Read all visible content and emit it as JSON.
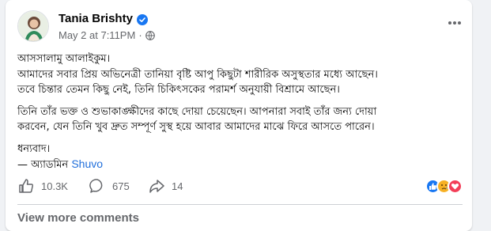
{
  "post": {
    "author": "Tania Brishty",
    "timestamp": "May 2 at 7:11PM",
    "separator": "·",
    "verified": true,
    "lines": [
      "আসসালামু আলাইকুম।",
      "আমাদের সবার প্রিয় অভিনেত্রী তানিয়া বৃষ্টি আপু কিছুটা শারীরিক অসুস্থতার মধ্যে আছেন।",
      "তবে চিন্তার তেমন কিছু নেই, তিনি চিকিৎসকের পরামর্শ অনুযায়ী বিশ্রামে আছেন।",
      "তিনি তাঁর ভক্ত ও শুভাকাঙ্ক্ষীদের কাছে দোয়া চেয়েছেন। আপনারা সবাই তাঁর জন্য দোয়া",
      "করবেন, যেন তিনি খুব দ্রুত সম্পূর্ণ সুস্থ হয়ে আবার আমাদের মাঝে ফিরে আসতে পারেন।",
      "ধন্যবাদ।",
      "— অ্যাডমিন"
    ],
    "signature_link": "Shuvo"
  },
  "actions": {
    "likes": "10.3K",
    "comments": "675",
    "shares": "14"
  },
  "reactions": [
    "like-reaction",
    "sad-reaction",
    "love-reaction"
  ],
  "footer": {
    "view_comments": "View more comments"
  },
  "colors": {
    "verified": "#1877f2",
    "link": "#216fdb",
    "secondary_text": "#65676b",
    "like": "#1877f2",
    "sad": "#f7b125",
    "love": "#f33e58"
  }
}
